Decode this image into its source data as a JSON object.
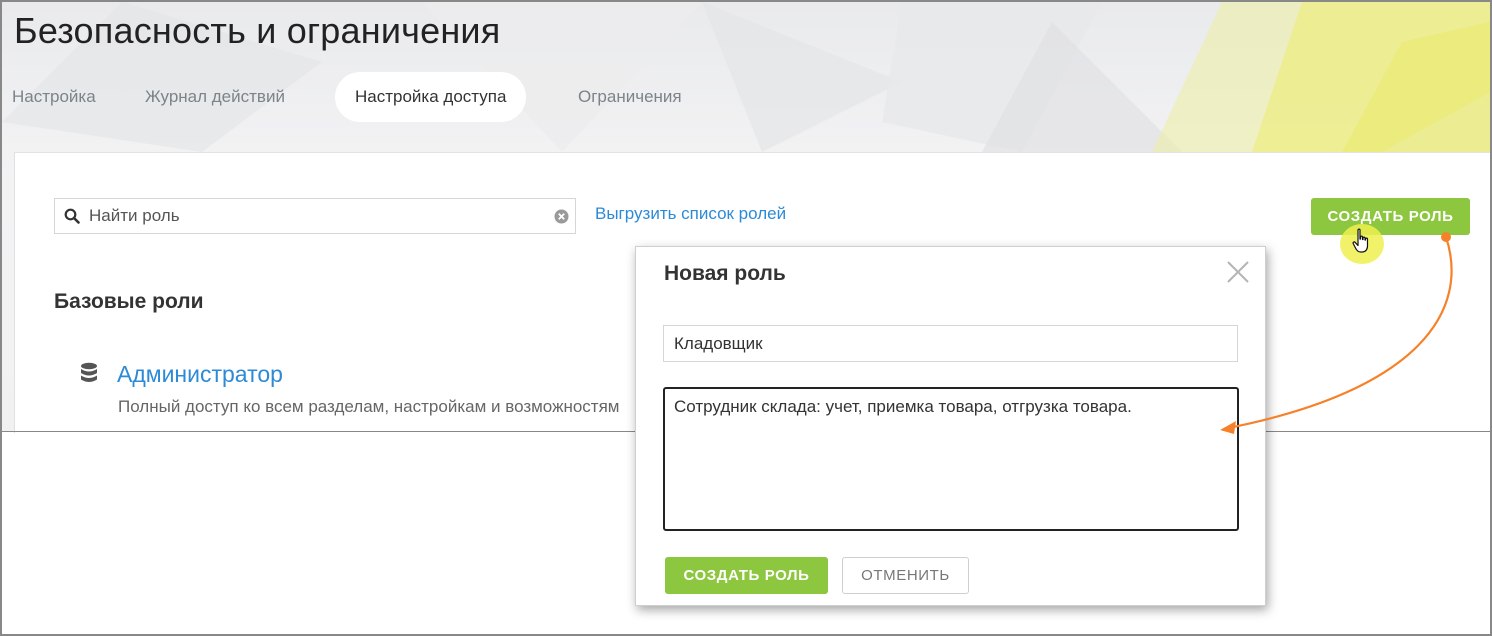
{
  "page": {
    "title": "Безопасность и ограничения"
  },
  "tabs": [
    {
      "label": "Настройка",
      "active": false
    },
    {
      "label": "Журнал действий",
      "active": false
    },
    {
      "label": "Настройка доступа",
      "active": true
    },
    {
      "label": "Ограничения",
      "active": false
    }
  ],
  "toolbar": {
    "search_placeholder": "Найти роль",
    "search_value": "",
    "export_link": "Выгрузить список ролей",
    "create_role_button": "СОЗДАТЬ РОЛЬ"
  },
  "roles_section": {
    "title": "Базовые роли",
    "roles": [
      {
        "name": "Администратор",
        "description": "Полный доступ ко всем разделам, настройкам и возможностям",
        "icon": "database-icon"
      }
    ]
  },
  "modal": {
    "title": "Новая роль",
    "name_value": "Кладовщик",
    "description_value": "Сотрудник склада: учет, приемка товара, отгрузка товара.",
    "create_button": "СОЗДАТЬ РОЛЬ",
    "cancel_button": "ОТМЕНИТЬ"
  },
  "colors": {
    "accent_green": "#8dc63f",
    "link_blue": "#2d8ad6",
    "annotation_orange": "#f5822a",
    "highlight_yellow": "#f0f050"
  },
  "icons": [
    "search-icon",
    "clear-icon",
    "database-icon",
    "close-icon",
    "hand-pointer-icon"
  ]
}
